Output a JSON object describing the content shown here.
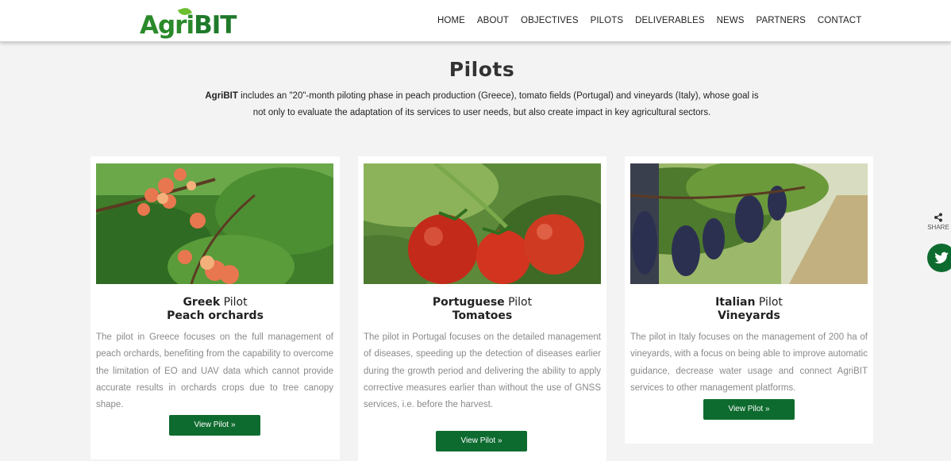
{
  "header": {
    "logo_main": "Agri",
    "logo_accent": "BIT",
    "nav": [
      "HOME",
      "ABOUT",
      "OBJECTIVES",
      "PILOTS",
      "DELIVERABLES",
      "NEWS",
      "PARTNERS",
      "CONTACT"
    ]
  },
  "page": {
    "title": "Pilots",
    "intro_brand": "AgriBIT",
    "intro_line1": " includes an \"20\"-month piloting phase in peach production (Greece), tomato fields (Portugal) and vineyards (Italy), whose goal is",
    "intro_line2": "not only to evaluate the adaptation of its services to user needs, but also create impact in key agricultural sectors."
  },
  "cards": [
    {
      "country": "Greek",
      "pilot_word": " Pilot",
      "subtitle": "Peach orchards",
      "description": "The pilot in Greece focuses on the full management of peach orchards, benefiting from the capability to overcome the limitation of EO and UAV data which cannot provide accurate results in orchards crops due to tree canopy shape.",
      "button": "View Pilot »"
    },
    {
      "country": "Portuguese",
      "pilot_word": " Pilot",
      "subtitle": "Tomatoes",
      "description": "The pilot in Portugal focuses on the detailed management of diseases, speeding up the detection of diseases earlier during the growth period and delivering the ability to apply corrective measures earlier than without the use of GNSS services, i.e. before the harvest.",
      "button": "View Pilot »"
    },
    {
      "country": "Italian",
      "pilot_word": " Pilot",
      "subtitle": "Vineyards",
      "description": "The pilot in Italy focuses on the management of 200 ha of vineyards, with a focus on being able to improve automatic guidance, decrease water usage and connect AgriBIT services to other management platforms.",
      "button": "View Pilot »"
    }
  ],
  "share": {
    "label": "SHARE",
    "icon": "share-icon",
    "twitter_icon": "twitter-icon"
  },
  "colors": {
    "brand_green": "#0e6b2f",
    "logo_green": "#2a8a2a",
    "background": "#f3f3f3"
  }
}
